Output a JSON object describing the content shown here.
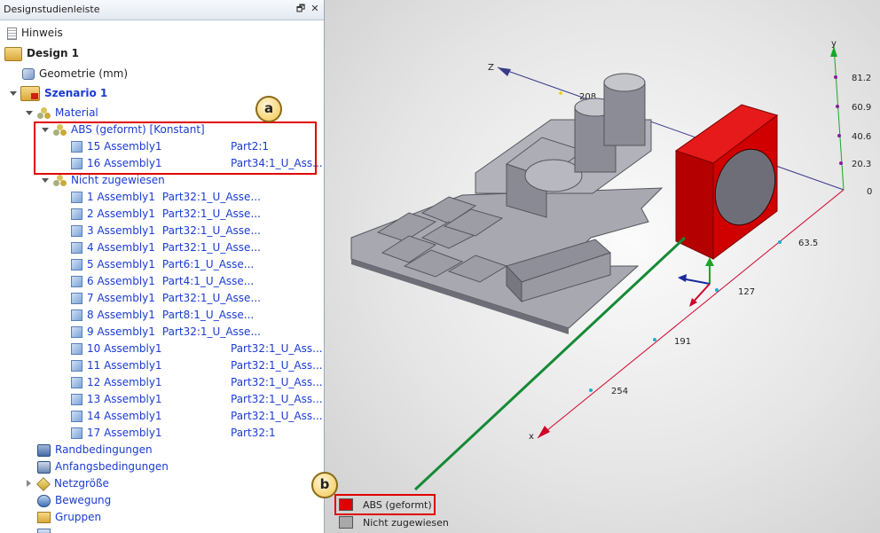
{
  "panel": {
    "title": "Designstudienleiste",
    "restore_glyph": "🗗",
    "close_glyph": "✕"
  },
  "tree": {
    "hinweis": "Hinweis",
    "design": "Design 1",
    "geometrie": "Geometrie (mm)",
    "szenario": "Szenario 1",
    "material": "Material",
    "abs": "ABS (geformt) [Konstant]",
    "abs_items": [
      {
        "name": "15 Assembly1",
        "part": "Part2:1"
      },
      {
        "name": "16 Assembly1",
        "part": "Part34:1_U_Ass..."
      }
    ],
    "nicht": "Nicht zugewiesen",
    "nicht_items_short": [
      {
        "name": "1 Assembly1",
        "part": "Part32:1_U_Asse..."
      },
      {
        "name": "2 Assembly1",
        "part": "Part32:1_U_Asse..."
      },
      {
        "name": "3 Assembly1",
        "part": "Part32:1_U_Asse..."
      },
      {
        "name": "4 Assembly1",
        "part": "Part32:1_U_Asse..."
      },
      {
        "name": "5 Assembly1",
        "part": "Part6:1_U_Asse..."
      },
      {
        "name": "6 Assembly1",
        "part": "Part4:1_U_Asse..."
      },
      {
        "name": "7 Assembly1",
        "part": "Part32:1_U_Asse..."
      },
      {
        "name": "8 Assembly1",
        "part": "Part8:1_U_Asse..."
      },
      {
        "name": "9 Assembly1",
        "part": "Part32:1_U_Asse..."
      }
    ],
    "nicht_items_long": [
      {
        "name": "10 Assembly1",
        "part": "Part32:1_U_Ass..."
      },
      {
        "name": "11 Assembly1",
        "part": "Part32:1_U_Ass..."
      },
      {
        "name": "12 Assembly1",
        "part": "Part32:1_U_Ass..."
      },
      {
        "name": "13 Assembly1",
        "part": "Part32:1_U_Ass..."
      },
      {
        "name": "14 Assembly1",
        "part": "Part32:1_U_Ass..."
      },
      {
        "name": "17 Assembly1",
        "part": "Part32:1"
      }
    ],
    "randbedingungen": "Randbedingungen",
    "anfangsbedingungen": "Anfangsbedingungen",
    "netzgroesse": "Netzgröße",
    "bewegung": "Bewegung",
    "gruppen": "Gruppen"
  },
  "callouts": {
    "a": "a",
    "b": "b"
  },
  "legend": [
    {
      "label": "ABS (geformt)",
      "color": "#e00000"
    },
    {
      "label": "Nicht zugewiesen",
      "color": "#a9a9a9"
    }
  ],
  "axes": {
    "z_label": "Z",
    "y_label": "y",
    "x_label": "x",
    "z_value": "208",
    "y_ticks": [
      "81.2",
      "60.9",
      "40.6",
      "20.3",
      "0"
    ],
    "x_ticks": [
      "63.5",
      "127",
      "191",
      "254"
    ]
  },
  "colors": {
    "tree_link": "#1a3bd1",
    "highlight_red": "#e00000",
    "part_red": "#d10000",
    "part_gray": "#a4a4ac"
  }
}
